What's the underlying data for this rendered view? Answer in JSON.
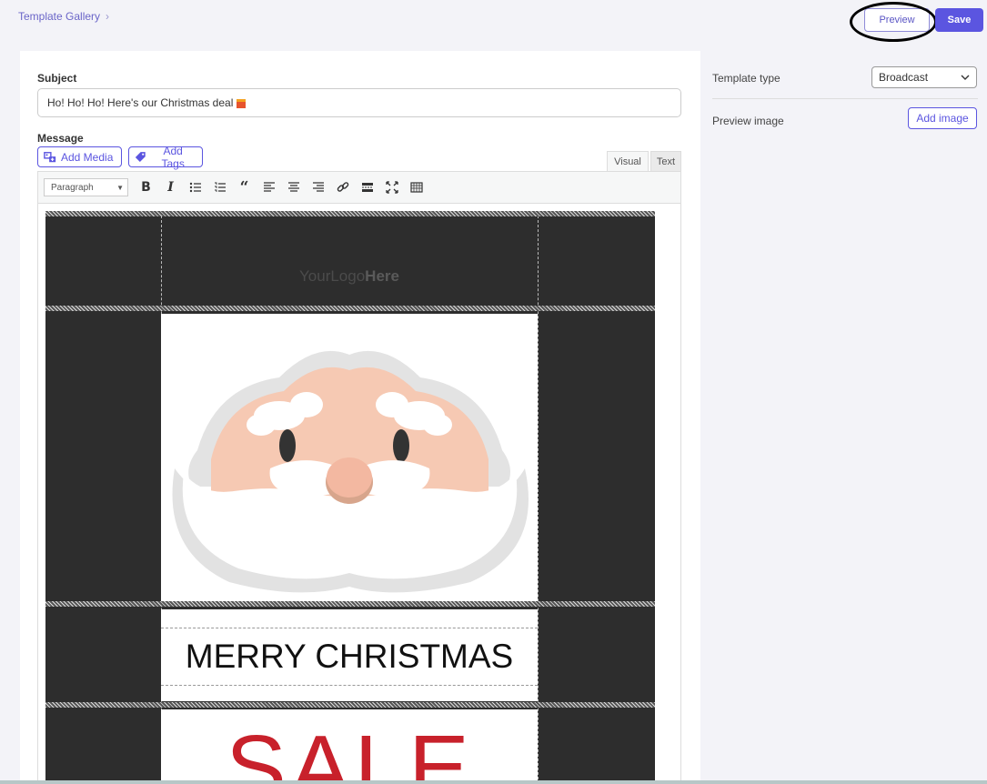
{
  "header": {
    "breadcrumb": "Template Gallery",
    "preview_label": "Preview",
    "save_label": "Save"
  },
  "form": {
    "subject_label": "Subject",
    "subject_value": "Ho! Ho! Ho! Here's our Christmas deal",
    "message_label": "Message",
    "add_media_label": "Add Media",
    "add_tags_label": "Add Tags",
    "tab_visual": "Visual",
    "tab_text": "Text",
    "format_value": "Paragraph"
  },
  "email": {
    "logo_prefix": "YourLogo",
    "logo_bold": "Here",
    "headline": "MERRY CHRISTMAS",
    "sale_text": "SALE"
  },
  "sidebar": {
    "template_type_label": "Template type",
    "template_type_value": "Broadcast",
    "preview_image_label": "Preview image",
    "add_image_label": "Add image"
  },
  "colors": {
    "accent": "#5b55e0",
    "email_bg": "#2d2d2d",
    "sale_red": "#c8212b"
  },
  "icons": {
    "toolbar": [
      "bold-icon",
      "italic-icon",
      "bullet-list-icon",
      "numbered-list-icon",
      "blockquote-icon",
      "align-left-icon",
      "align-center-icon",
      "align-right-icon",
      "link-icon",
      "read-more-icon",
      "fullscreen-icon",
      "toolbar-toggle-icon"
    ]
  }
}
